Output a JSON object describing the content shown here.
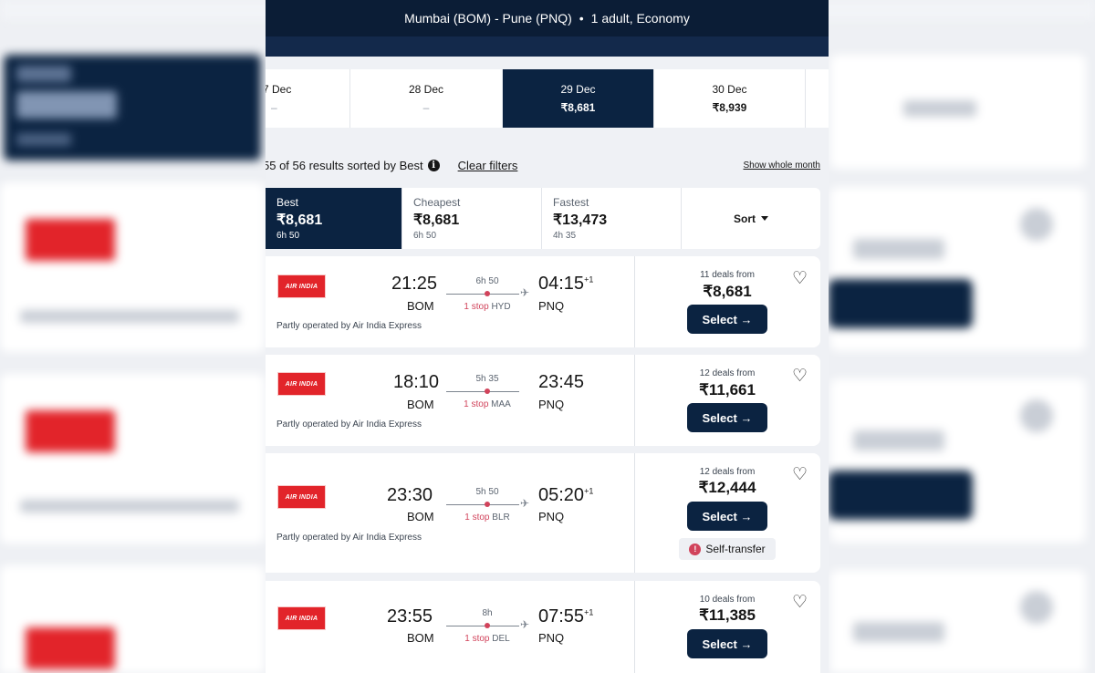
{
  "header": {
    "route": "Mumbai (BOM) - Pune (PNQ)",
    "separator": "•",
    "travellers": "1 adult, Economy"
  },
  "dates": [
    {
      "label": "7 Dec",
      "price": "–",
      "selected": false
    },
    {
      "label": "28 Dec",
      "price": "–",
      "selected": false
    },
    {
      "label": "29 Dec",
      "price": "₹8,681",
      "selected": true
    },
    {
      "label": "30 Dec",
      "price": "₹8,939",
      "selected": false
    }
  ],
  "results": {
    "count_text": "55 of 56 results sorted by Best",
    "info_icon": "i",
    "clear_filters": "Clear filters",
    "whole_month": "Show whole month"
  },
  "sort_tabs": [
    {
      "label": "Best",
      "price": "₹8,681",
      "duration": "6h 50",
      "active": true
    },
    {
      "label": "Cheapest",
      "price": "₹8,681",
      "duration": "6h 50",
      "active": false
    },
    {
      "label": "Fastest",
      "price": "₹13,473",
      "duration": "4h 35",
      "active": false
    }
  ],
  "sort_button": {
    "label": "Sort"
  },
  "flights": [
    {
      "airline_logo": "AIR INDIA",
      "dep_time": "21:25",
      "dep_code": "BOM",
      "arr_time": "04:15",
      "arr_plus": "+1",
      "arr_code": "PNQ",
      "duration": "6h 50",
      "stops": "1 stop",
      "via": "HYD",
      "operated": "Partly operated by Air India Express",
      "deals": "11 deals from",
      "price": "₹8,681",
      "select": "Select →",
      "self_transfer": null
    },
    {
      "airline_logo": "AIR INDIA",
      "dep_time": "18:10",
      "dep_code": "BOM",
      "arr_time": "23:45",
      "arr_plus": "",
      "arr_code": "PNQ",
      "duration": "5h 35",
      "stops": "1 stop",
      "via": "MAA",
      "operated": "Partly operated by Air India Express",
      "deals": "12 deals from",
      "price": "₹11,661",
      "select": "Select →",
      "self_transfer": null
    },
    {
      "airline_logo": "AIR INDIA",
      "dep_time": "23:30",
      "dep_code": "BOM",
      "arr_time": "05:20",
      "arr_plus": "+1",
      "arr_code": "PNQ",
      "duration": "5h 50",
      "stops": "1 stop",
      "via": "BLR",
      "operated": "Partly operated by Air India Express",
      "deals": "12 deals from",
      "price": "₹12,444",
      "select": "Select →",
      "self_transfer": "Self-transfer"
    },
    {
      "airline_logo": "AIR INDIA",
      "dep_time": "23:55",
      "dep_code": "BOM",
      "arr_time": "07:55",
      "arr_plus": "+1",
      "arr_code": "PNQ",
      "duration": "8h",
      "stops": "1 stop",
      "via": "DEL",
      "operated": "",
      "deals": "10 deals from",
      "price": "₹11,385",
      "select": "Select →",
      "self_transfer": null
    }
  ],
  "colors": {
    "navy": "#0b2341",
    "header": "#0b1d36",
    "stop_red": "#d1435b",
    "airline_red": "#e2242a"
  }
}
